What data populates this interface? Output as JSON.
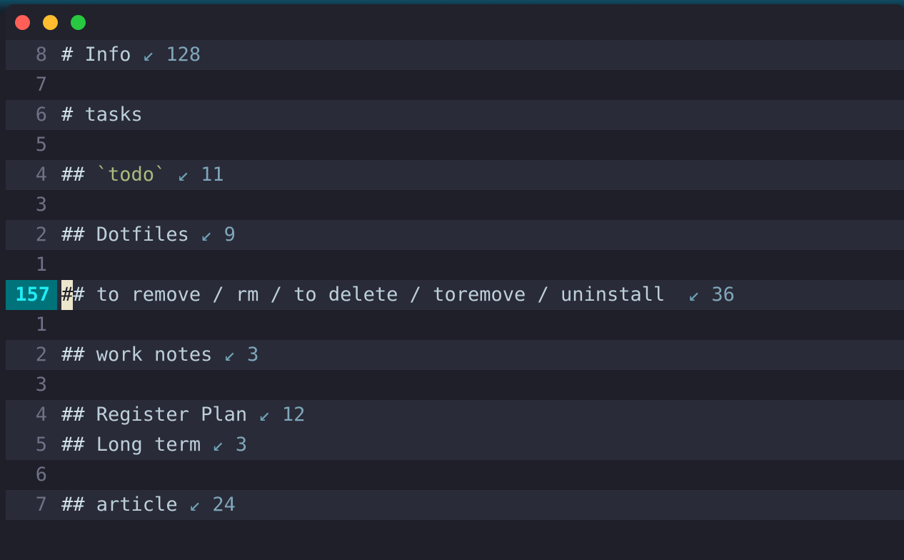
{
  "window": {
    "traffic_lights": [
      {
        "name": "close-button",
        "color": "#ff5f57"
      },
      {
        "name": "minimize-button",
        "color": "#febc2e"
      },
      {
        "name": "maximize-button",
        "color": "#28c840"
      }
    ],
    "background": "#1e1f29",
    "titlebar_background": "#21222c"
  },
  "editor": {
    "cursor_line_number": "157",
    "cursor_char": "#",
    "cursor_gutter_bg": "#00737a",
    "cursor_gutter_fg": "#22ecf5",
    "cursor_block_bg": "#ece6cd",
    "fold_arrow_glyph": "↙",
    "lines": [
      {
        "num": "8",
        "band": true,
        "cursor": false,
        "hash": "#",
        "text": "Info",
        "code": false,
        "arrow": "↙",
        "count": "128"
      },
      {
        "num": "7",
        "band": false,
        "cursor": false,
        "hash": "",
        "text": "",
        "code": false,
        "arrow": "",
        "count": ""
      },
      {
        "num": "6",
        "band": true,
        "cursor": false,
        "hash": "#",
        "text": "tasks",
        "code": false,
        "arrow": "",
        "count": ""
      },
      {
        "num": "5",
        "band": false,
        "cursor": false,
        "hash": "",
        "text": "",
        "code": false,
        "arrow": "",
        "count": ""
      },
      {
        "num": "4",
        "band": true,
        "cursor": false,
        "hash": "##",
        "text": "`todo`",
        "code": true,
        "arrow": "↙",
        "count": "11"
      },
      {
        "num": "3",
        "band": false,
        "cursor": false,
        "hash": "",
        "text": "",
        "code": false,
        "arrow": "",
        "count": ""
      },
      {
        "num": "2",
        "band": true,
        "cursor": false,
        "hash": "##",
        "text": "Dotfiles",
        "code": false,
        "arrow": "↙",
        "count": "9"
      },
      {
        "num": "1",
        "band": false,
        "cursor": false,
        "hash": "",
        "text": "",
        "code": false,
        "arrow": "",
        "count": ""
      },
      {
        "num": "157",
        "band": true,
        "cursor": true,
        "hash": "##",
        "text": "to remove / rm / to delete / toremove / uninstall",
        "code": false,
        "arrow": "↙",
        "count": "36"
      },
      {
        "num": "1",
        "band": false,
        "cursor": false,
        "hash": "",
        "text": "",
        "code": false,
        "arrow": "",
        "count": ""
      },
      {
        "num": "2",
        "band": true,
        "cursor": false,
        "hash": "##",
        "text": "work notes",
        "code": false,
        "arrow": "↙",
        "count": "3"
      },
      {
        "num": "3",
        "band": false,
        "cursor": false,
        "hash": "",
        "text": "",
        "code": false,
        "arrow": "",
        "count": ""
      },
      {
        "num": "4",
        "band": true,
        "cursor": false,
        "hash": "##",
        "text": "Register Plan",
        "code": false,
        "arrow": "↙",
        "count": "12"
      },
      {
        "num": "5",
        "band": true,
        "cursor": false,
        "hash": "##",
        "text": "Long term",
        "code": false,
        "arrow": "↙",
        "count": "3"
      },
      {
        "num": "6",
        "band": false,
        "cursor": false,
        "hash": "",
        "text": "",
        "code": false,
        "arrow": "",
        "count": ""
      },
      {
        "num": "7",
        "band": true,
        "cursor": false,
        "hash": "##",
        "text": "article",
        "code": false,
        "arrow": "↙",
        "count": "24"
      }
    ]
  }
}
